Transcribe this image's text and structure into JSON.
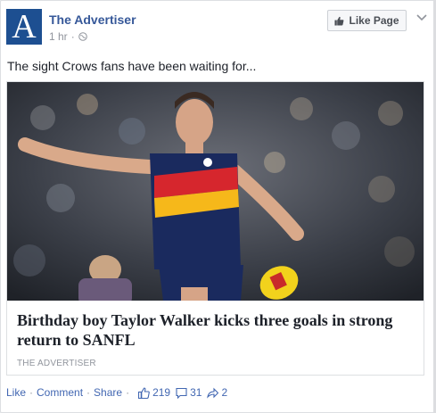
{
  "page": {
    "name": "The Advertiser",
    "avatar_letter": "A",
    "time": "1 hr",
    "privacy_icon": "globe-icon",
    "like_page_label": "Like Page"
  },
  "post": {
    "text": "The sight Crows fans have been waiting for...",
    "link": {
      "headline": "Birthday boy Taylor Walker kicks three goals in strong return to SANFL",
      "source": "THE ADVERTISER"
    }
  },
  "actions": {
    "like": "Like",
    "comment": "Comment",
    "share": "Share",
    "separator": "·",
    "likes_count": "219",
    "comments_count": "31",
    "shares_count": "2"
  },
  "colors": {
    "brand_blue": "#365899",
    "link_blue": "#4267b2",
    "avatar_blue": "#1d4f91",
    "meta_gray": "#90949c",
    "jersey_red": "#d6262d",
    "jersey_gold": "#f6b81a",
    "jersey_navy": "#1a2a5e"
  }
}
